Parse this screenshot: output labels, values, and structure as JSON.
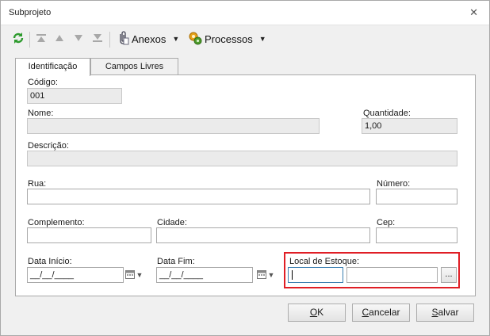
{
  "window": {
    "title": "Subprojeto",
    "close_glyph": "✕"
  },
  "toolbar": {
    "refresh_icon": "refresh-icon",
    "first_glyph": "⏫",
    "prev_glyph": "▲",
    "next_glyph": "▼",
    "last_glyph": "⏬",
    "anexos_label": "Anexos",
    "processos_label": "Processos",
    "dropdown_glyph": "▼"
  },
  "tabs": [
    {
      "label": "Identificação"
    },
    {
      "label": "Campos Livres"
    }
  ],
  "form": {
    "codigo": {
      "label": "Código:",
      "value": "001"
    },
    "nome": {
      "label": "Nome:",
      "value": ""
    },
    "quantidade": {
      "label": "Quantidade:",
      "value": "1,00"
    },
    "descricao": {
      "label": "Descrição:",
      "value": ""
    },
    "rua": {
      "label": "Rua:",
      "value": ""
    },
    "numero": {
      "label": "Número:",
      "value": ""
    },
    "complemento": {
      "label": "Complemento:",
      "value": ""
    },
    "cidade": {
      "label": "Cidade:",
      "value": ""
    },
    "cep": {
      "label": "Cep:",
      "value": ""
    },
    "data_inicio": {
      "label": "Data Início:",
      "value": "__/__/____"
    },
    "data_fim": {
      "label": "Data Fim:",
      "value": "__/__/____"
    },
    "local_estoque": {
      "label": "Local de Estoque:",
      "code": "",
      "description": "",
      "browse_label": "..."
    }
  },
  "buttons": {
    "ok": {
      "mnemonic": "O",
      "rest": "K"
    },
    "cancelar": {
      "mnemonic": "C",
      "rest": "ancelar"
    },
    "salvar": {
      "mnemonic": "S",
      "rest": "alvar"
    }
  },
  "colors": {
    "highlight": "#e01e25",
    "refresh_green": "#2e9b2e"
  }
}
